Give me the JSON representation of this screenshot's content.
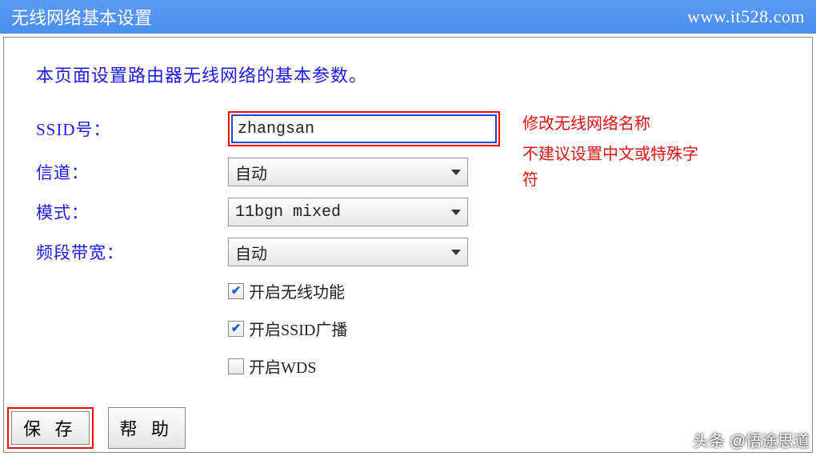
{
  "titlebar": {
    "title": "无线网络基本设置",
    "url": "www.it528.com"
  },
  "intro": "本页面设置路由器无线网络的基本参数。",
  "form": {
    "ssid": {
      "label": "SSID号：",
      "value": "zhangsan"
    },
    "channel": {
      "label": "信道：",
      "value": "自动"
    },
    "mode": {
      "label": "模式：",
      "value": "11bgn mixed"
    },
    "bandwidth": {
      "label": "频段带宽：",
      "value": "自动"
    },
    "checks": {
      "wireless": {
        "label": "开启无线功能",
        "checked": true
      },
      "ssid_broadcast": {
        "label": "开启SSID广播",
        "checked": true
      },
      "wds": {
        "label": "开启WDS",
        "checked": false
      }
    }
  },
  "annotations": {
    "line1": "修改无线网络名称",
    "line2": "不建议设置中文或特殊字符"
  },
  "buttons": {
    "save": "保 存",
    "help": "帮 助"
  },
  "watermark": "头条 @悟途思道"
}
